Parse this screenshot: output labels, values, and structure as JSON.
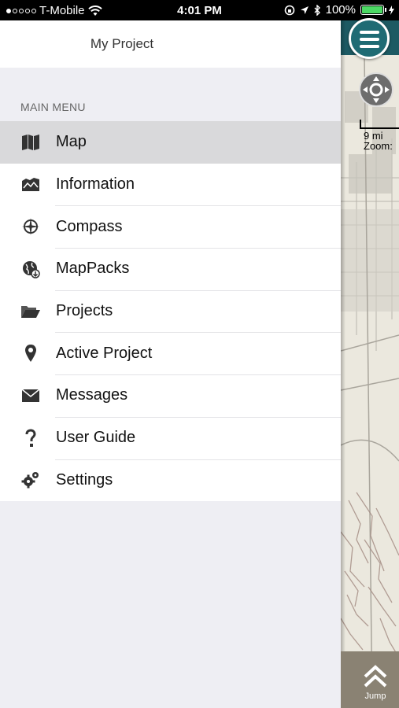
{
  "status_bar": {
    "carrier": "T-Mobile",
    "time": "4:01 PM",
    "battery": "100%"
  },
  "drawer": {
    "project_title": "My Project",
    "section_header": "MAIN MENU",
    "items": [
      {
        "label": "Map",
        "icon": "map-icon",
        "active": true
      },
      {
        "label": "Information",
        "icon": "information-icon",
        "active": false
      },
      {
        "label": "Compass",
        "icon": "compass-icon",
        "active": false
      },
      {
        "label": "MapPacks",
        "icon": "globe-download-icon",
        "active": false
      },
      {
        "label": "Projects",
        "icon": "folder-icon",
        "active": false
      },
      {
        "label": "Active Project",
        "icon": "location-pin-icon",
        "active": false
      },
      {
        "label": "Messages",
        "icon": "envelope-icon",
        "active": false
      },
      {
        "label": "User Guide",
        "icon": "question-icon",
        "active": false
      },
      {
        "label": "Settings",
        "icon": "gears-icon",
        "active": false
      }
    ]
  },
  "map": {
    "scale_label": "9 mi",
    "zoom_label": "Zoom:",
    "jump_label": "Jump"
  },
  "colors": {
    "accent_teal": "#1f6b74",
    "active_row": "#d9d9db",
    "battery_green": "#4cd964"
  }
}
